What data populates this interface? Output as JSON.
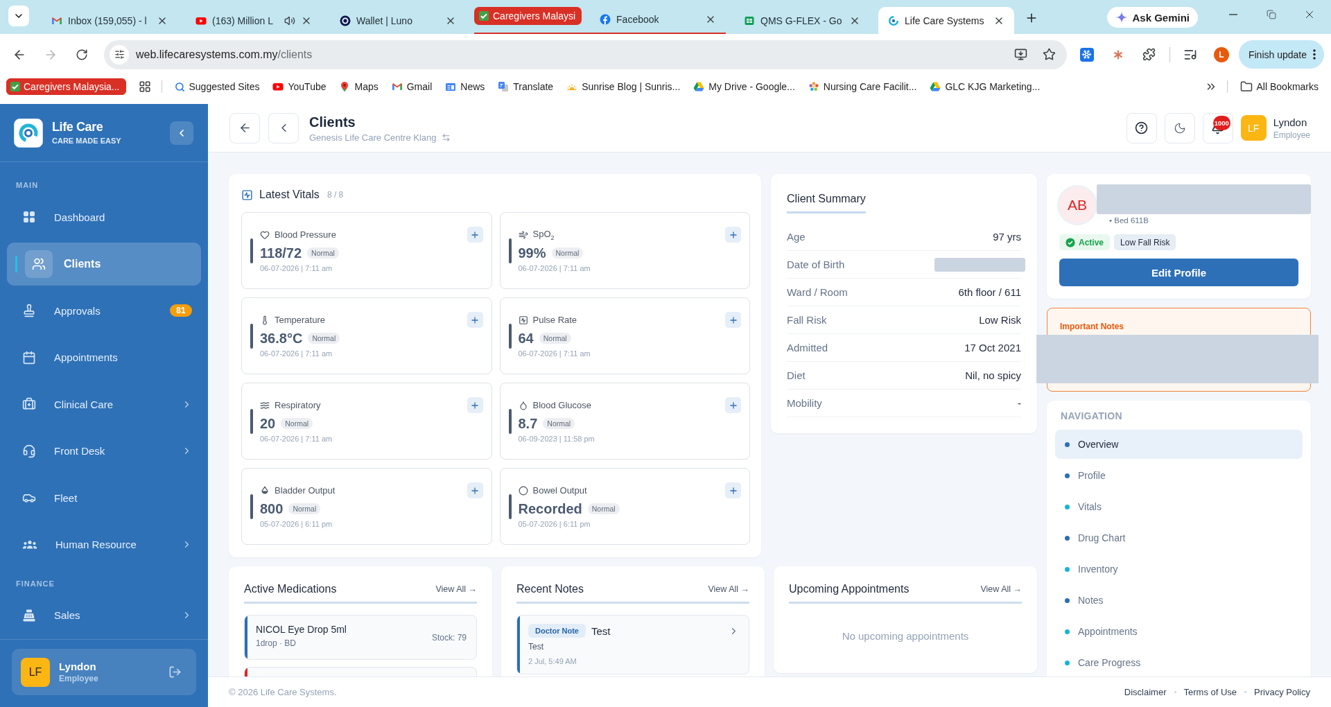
{
  "browser": {
    "tabs": [
      {
        "kind": "tab",
        "title": "Inbox (159,055) - l",
        "selected": false,
        "audible": false
      },
      {
        "kind": "tab",
        "title": "(163) Million L",
        "selected": false,
        "audible": true
      },
      {
        "kind": "tab",
        "title": "Wallet | Luno",
        "selected": false,
        "audible": false
      },
      {
        "kind": "group",
        "title": "Caregivers Malaysi",
        "color": "#d93025",
        "tabs": [
          {
            "kind": "tab",
            "title": "Facebook",
            "selected": false,
            "audible": false
          }
        ]
      },
      {
        "kind": "tab",
        "title": "QMS G-FLEX - Go",
        "selected": false,
        "audible": false
      },
      {
        "kind": "tab",
        "title": "Life Care Systems",
        "selected": true,
        "audible": false
      }
    ],
    "gemini_button": "Ask Gemini",
    "navigation": {
      "back_disabled": false,
      "forward_disabled": true
    },
    "address": {
      "host": "web.lifecaresystems.com.my",
      "path": "/clients"
    },
    "profile_initial": "L",
    "update_button": "Finish update",
    "bookmarks": [
      {
        "kind": "group",
        "title": "Caregivers Malaysia...",
        "color": "#d93025"
      },
      {
        "kind": "link",
        "title": "Suggested Sites"
      },
      {
        "kind": "link",
        "title": "YouTube"
      },
      {
        "kind": "link",
        "title": "Maps"
      },
      {
        "kind": "link",
        "title": "Gmail"
      },
      {
        "kind": "link",
        "title": "News"
      },
      {
        "kind": "link",
        "title": "Translate"
      },
      {
        "kind": "link",
        "title": "Sunrise Blog | Sunris..."
      },
      {
        "kind": "link",
        "title": "My Drive - Google..."
      },
      {
        "kind": "link",
        "title": "Nursing Care Facilit..."
      },
      {
        "kind": "link",
        "title": "GLC KJG Marketing..."
      }
    ],
    "all_bookmarks": "All Bookmarks"
  },
  "sidebar": {
    "brand": {
      "name": "Life Care",
      "tagline": "CARE MADE EASY"
    },
    "sections": [
      {
        "label": "MAIN",
        "items": [
          {
            "label": "Dashboard",
            "selected": false,
            "submenu": false
          },
          {
            "label": "Clients",
            "selected": true,
            "submenu": false
          },
          {
            "label": "Approvals",
            "selected": false,
            "submenu": false,
            "badge": "81"
          },
          {
            "label": "Appointments",
            "selected": false,
            "submenu": false
          },
          {
            "label": "Clinical Care",
            "selected": false,
            "submenu": true
          },
          {
            "label": "Front Desk",
            "selected": false,
            "submenu": true
          },
          {
            "label": "Fleet",
            "selected": false,
            "submenu": false
          },
          {
            "label": "Human Resource",
            "selected": false,
            "submenu": true
          }
        ]
      },
      {
        "label": "FINANCE",
        "items": [
          {
            "label": "Sales",
            "selected": false,
            "submenu": true
          }
        ]
      }
    ],
    "user": {
      "initials": "LF",
      "name": "Lyndon",
      "role": "Employee"
    }
  },
  "header": {
    "title": "Clients",
    "location": "Genesis Life Care Centre Klang",
    "notification_count": "1000",
    "user": {
      "initials": "LF",
      "name": "Lyndon",
      "role": "Employee"
    }
  },
  "vitals": {
    "title": "Latest Vitals",
    "count": "8 / 8",
    "items": [
      {
        "label": "Blood Pressure",
        "value": "118/72",
        "status": "Normal",
        "recorded": "06-07-2026 | 7:11 am"
      },
      {
        "label": "SpO$_{2}$",
        "value": "99%",
        "status": "Normal",
        "recorded": "06-07-2026 | 7:11 am"
      },
      {
        "label": "Temperature",
        "value": "36.8°C",
        "status": "Normal",
        "recorded": "06-07-2026 | 7:11 am"
      },
      {
        "label": "Pulse Rate",
        "value": "64",
        "status": "Normal",
        "recorded": "06-07-2026 | 7:11 am"
      },
      {
        "label": "Respiratory",
        "value": "20",
        "status": "Normal",
        "recorded": "06-07-2026 | 7:11 am"
      },
      {
        "label": "Blood Glucose",
        "value": "8.7",
        "status": "Normal",
        "recorded": "06-09-2023 | 11:58 pm"
      },
      {
        "label": "Bladder Output",
        "value": "800",
        "status": "Normal",
        "recorded": "05-07-2026 | 6:11 pm"
      },
      {
        "label": "Bowel Output",
        "value": "Recorded",
        "status": "Normal",
        "recorded": "05-07-2026 | 6:11 pm"
      }
    ]
  },
  "client_summary": {
    "title": "Client Summary",
    "rows": [
      {
        "label": "Age",
        "value": "97 yrs",
        "redacted": false
      },
      {
        "label": "Date of Birth",
        "redacted": true
      },
      {
        "label": "Ward / Room",
        "value": "6th floor / 611",
        "redacted": false
      },
      {
        "label": "Fall Risk",
        "value": "Low Risk",
        "redacted": false
      },
      {
        "label": "Admitted",
        "value": "17 Oct 2021",
        "redacted": false
      },
      {
        "label": "Diet",
        "value": "Nil, no spicy",
        "redacted": false
      },
      {
        "label": "Mobility",
        "value": "-",
        "redacted": false
      }
    ]
  },
  "profile": {
    "initials": "AB",
    "name_redacted": true,
    "bed": "• Bed 611B",
    "badges": [
      {
        "kind": "status",
        "label": "Active"
      },
      {
        "kind": "risk",
        "label": "Low Fall Risk"
      }
    ],
    "edit_button": "Edit Profile"
  },
  "important_notes": {
    "title": "Important Notes",
    "redacted": true
  },
  "navigation": {
    "title": "NAVIGATION",
    "items": [
      {
        "label": "Overview",
        "selected": true,
        "color": "#2f6db5"
      },
      {
        "label": "Profile",
        "selected": false,
        "color": "#2f6db5"
      },
      {
        "label": "Vitals",
        "selected": false,
        "color": "#16b5d6"
      },
      {
        "label": "Drug Chart",
        "selected": false,
        "color": "#2f6db5"
      },
      {
        "label": "Inventory",
        "selected": false,
        "color": "#16b5d6"
      },
      {
        "label": "Notes",
        "selected": false,
        "color": "#2f6db5"
      },
      {
        "label": "Appointments",
        "selected": false,
        "color": "#16b5d6"
      },
      {
        "label": "Care Progress",
        "selected": false,
        "color": "#16b5d6"
      }
    ]
  },
  "medications": {
    "title": "Active Medications",
    "link": "View All →",
    "items": [
      {
        "name": "NICOL Eye Drop 5ml",
        "dose": "1drop · BD",
        "stock": "Stock: 79",
        "color": "#2f6db5"
      },
      {
        "color": "#dc2626"
      }
    ]
  },
  "recent_notes": {
    "title": "Recent Notes",
    "link": "View All →",
    "items": [
      {
        "tag": "Doctor Note",
        "title": "Test",
        "body": "Test",
        "time": "2 Jul, 5:49 AM",
        "color": "#2f6db5"
      }
    ]
  },
  "appointments": {
    "title": "Upcoming Appointments",
    "link": "View All →",
    "empty": "No upcoming appointments"
  },
  "footer": {
    "copyright": "© 2026 Life Care Systems.",
    "links": [
      "Disclaimer",
      "Terms of Use",
      "Privacy Policy"
    ]
  }
}
